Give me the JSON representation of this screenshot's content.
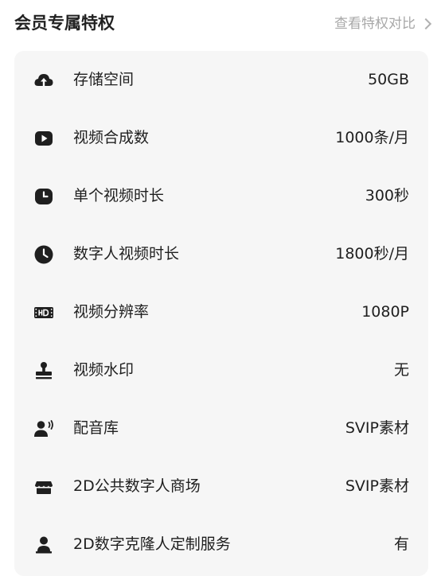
{
  "header": {
    "title": "会员专属特权",
    "link_label": "查看特权对比"
  },
  "rows": [
    {
      "label": "存储空间",
      "value": "50GB",
      "icon": "cloud-upload-icon"
    },
    {
      "label": "视频合成数",
      "value": "1000条/月",
      "icon": "play-icon"
    },
    {
      "label": "单个视频时长",
      "value": "300秒",
      "icon": "clock-square-icon"
    },
    {
      "label": "数字人视频时长",
      "value": "1800秒/月",
      "icon": "clock-icon"
    },
    {
      "label": "视频分辨率",
      "value": "1080P",
      "icon": "hd-icon"
    },
    {
      "label": "视频水印",
      "value": "无",
      "icon": "stamp-icon"
    },
    {
      "label": "配音库",
      "value": "SVIP素材",
      "icon": "voice-person-icon"
    },
    {
      "label": "2D公共数字人商场",
      "value": "SVIP素材",
      "icon": "store-icon"
    },
    {
      "label": "2D数字克隆人定制服务",
      "value": "有",
      "icon": "person-icon"
    }
  ]
}
